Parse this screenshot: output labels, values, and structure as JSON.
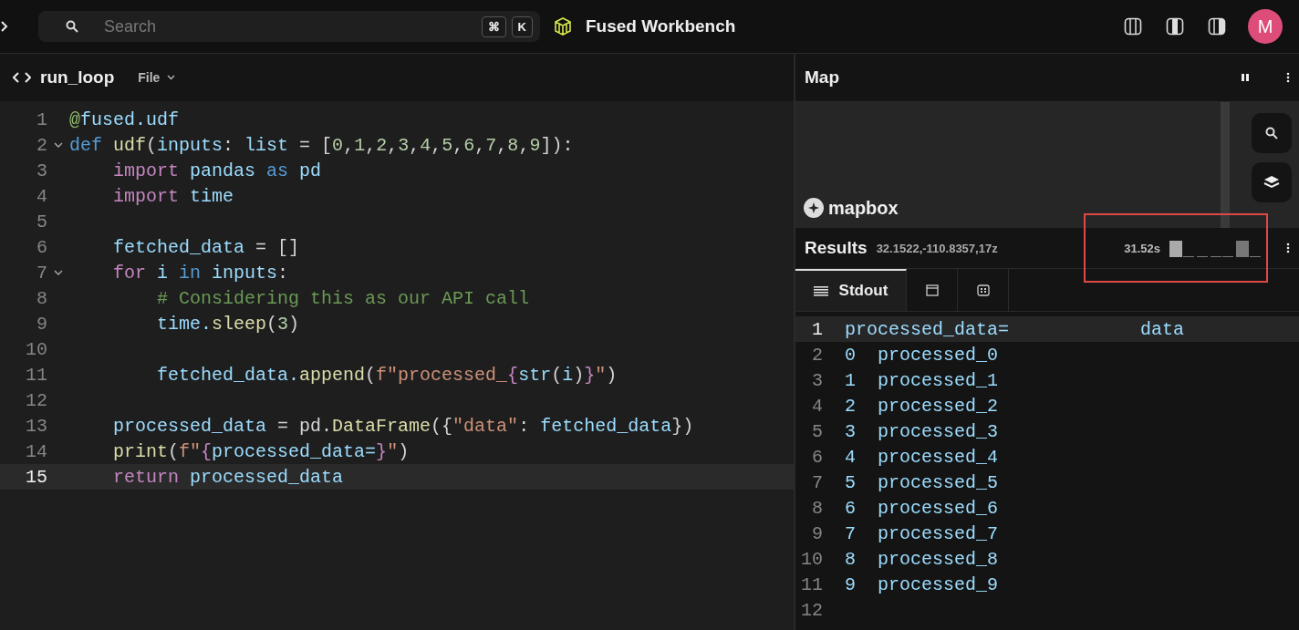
{
  "topbar": {
    "search": {
      "placeholder": "Search",
      "keys": [
        "⌘",
        "K"
      ]
    },
    "title": "Fused Workbench",
    "avatar": "M"
  },
  "editor": {
    "title": "run_loop",
    "menu": "File",
    "lines": [
      {
        "number": "1",
        "foldable": false,
        "current": false,
        "tokens": [
          {
            "text": "@",
            "kind": "dec"
          },
          {
            "text": "fused.udf",
            "kind": "id"
          }
        ]
      },
      {
        "number": "2",
        "foldable": true,
        "current": false,
        "tokens": [
          {
            "text": "def ",
            "kind": "kw"
          },
          {
            "text": "udf",
            "kind": "fn"
          },
          {
            "text": "(",
            "kind": "pun"
          },
          {
            "text": "inputs",
            "kind": "id"
          },
          {
            "text": ": ",
            "kind": "pun"
          },
          {
            "text": "list",
            "kind": "id"
          },
          {
            "text": " = [",
            "kind": "pun"
          },
          {
            "text": "0",
            "kind": "num"
          },
          {
            "text": ",",
            "kind": "pun"
          },
          {
            "text": "1",
            "kind": "num"
          },
          {
            "text": ",",
            "kind": "pun"
          },
          {
            "text": "2",
            "kind": "num"
          },
          {
            "text": ",",
            "kind": "pun"
          },
          {
            "text": "3",
            "kind": "num"
          },
          {
            "text": ",",
            "kind": "pun"
          },
          {
            "text": "4",
            "kind": "num"
          },
          {
            "text": ",",
            "kind": "pun"
          },
          {
            "text": "5",
            "kind": "num"
          },
          {
            "text": ",",
            "kind": "pun"
          },
          {
            "text": "6",
            "kind": "num"
          },
          {
            "text": ",",
            "kind": "pun"
          },
          {
            "text": "7",
            "kind": "num"
          },
          {
            "text": ",",
            "kind": "pun"
          },
          {
            "text": "8",
            "kind": "num"
          },
          {
            "text": ",",
            "kind": "pun"
          },
          {
            "text": "9",
            "kind": "num"
          },
          {
            "text": "]):",
            "kind": "pun"
          }
        ]
      },
      {
        "number": "3",
        "foldable": false,
        "current": false,
        "tokens": [
          {
            "text": "    import ",
            "kind": "ctl"
          },
          {
            "text": "pandas ",
            "kind": "id"
          },
          {
            "text": "as ",
            "kind": "kw"
          },
          {
            "text": "pd",
            "kind": "id"
          }
        ]
      },
      {
        "number": "4",
        "foldable": false,
        "current": false,
        "tokens": [
          {
            "text": "    import ",
            "kind": "ctl"
          },
          {
            "text": "time",
            "kind": "id"
          }
        ]
      },
      {
        "number": "5",
        "foldable": false,
        "current": false
      },
      {
        "number": "6",
        "foldable": false,
        "current": false,
        "tokens": [
          {
            "text": "    fetched_data",
            "kind": "id"
          },
          {
            "text": " = []",
            "kind": "pun"
          }
        ]
      },
      {
        "number": "7",
        "foldable": true,
        "current": false,
        "tokens": [
          {
            "text": "    for ",
            "kind": "ctl"
          },
          {
            "text": "i ",
            "kind": "id"
          },
          {
            "text": "in ",
            "kind": "kw"
          },
          {
            "text": "inputs",
            "kind": "id"
          },
          {
            "text": ":",
            "kind": "pun"
          }
        ]
      },
      {
        "number": "8",
        "foldable": false,
        "current": false,
        "tokens": [
          {
            "text": "        # Considering this as our API call",
            "kind": "com"
          }
        ]
      },
      {
        "number": "9",
        "foldable": false,
        "current": false,
        "tokens": [
          {
            "text": "        time.",
            "kind": "id"
          },
          {
            "text": "sleep",
            "kind": "fn"
          },
          {
            "text": "(",
            "kind": "pun"
          },
          {
            "text": "3",
            "kind": "num"
          },
          {
            "text": ")",
            "kind": "pun"
          }
        ]
      },
      {
        "number": "10",
        "foldable": false,
        "current": false
      },
      {
        "number": "11",
        "foldable": false,
        "current": false,
        "tokens": [
          {
            "text": "        fetched_data.",
            "kind": "id"
          },
          {
            "text": "append",
            "kind": "fn"
          },
          {
            "text": "(",
            "kind": "pun"
          },
          {
            "text": "f\"processed_",
            "kind": "str"
          },
          {
            "text": "{",
            "kind": "ctl"
          },
          {
            "text": "str",
            "kind": "id"
          },
          {
            "text": "(",
            "kind": "pun"
          },
          {
            "text": "i",
            "kind": "id"
          },
          {
            "text": ")",
            "kind": "pun"
          },
          {
            "text": "}",
            "kind": "ctl"
          },
          {
            "text": "\"",
            "kind": "str"
          },
          {
            "text": ")",
            "kind": "pun"
          }
        ]
      },
      {
        "number": "12",
        "foldable": false,
        "current": false
      },
      {
        "number": "13",
        "foldable": false,
        "current": false,
        "tokens": [
          {
            "text": "    processed_data",
            "kind": "id"
          },
          {
            "text": " = pd.",
            "kind": "pun"
          },
          {
            "text": "DataFrame",
            "kind": "fn"
          },
          {
            "text": "({",
            "kind": "pun"
          },
          {
            "text": "\"data\"",
            "kind": "str"
          },
          {
            "text": ": ",
            "kind": "pun"
          },
          {
            "text": "fetched_data",
            "kind": "id"
          },
          {
            "text": "})",
            "kind": "pun"
          }
        ]
      },
      {
        "number": "14",
        "foldable": false,
        "current": false,
        "tokens": [
          {
            "text": "    print",
            "kind": "fn"
          },
          {
            "text": "(",
            "kind": "pun"
          },
          {
            "text": "f\"",
            "kind": "str"
          },
          {
            "text": "{",
            "kind": "ctl"
          },
          {
            "text": "processed_data=",
            "kind": "id"
          },
          {
            "text": "}",
            "kind": "ctl"
          },
          {
            "text": "\"",
            "kind": "str"
          },
          {
            "text": ")",
            "kind": "pun"
          }
        ]
      },
      {
        "number": "15",
        "foldable": false,
        "current": true,
        "tokens": [
          {
            "text": "    return ",
            "kind": "ctl"
          },
          {
            "text": "processed_data",
            "kind": "id"
          }
        ]
      }
    ]
  },
  "map": {
    "title": "Map",
    "attribution": "mapbox"
  },
  "results": {
    "title": "Results",
    "coordinates": "32.1522,-110.8357,17z",
    "duration": "31.52s",
    "annotation": {
      "kind": "rectangle"
    },
    "tabs": [
      {
        "kind": "stdout",
        "label": "Stdout",
        "selected": true
      },
      {
        "kind": "window",
        "selected": false
      },
      {
        "kind": "table",
        "selected": false
      }
    ],
    "lines": [
      {
        "number": "1",
        "current": true,
        "text": "processed_data=            data"
      },
      {
        "number": "2",
        "current": false,
        "text": "0  processed_0"
      },
      {
        "number": "3",
        "current": false,
        "text": "1  processed_1"
      },
      {
        "number": "4",
        "current": false,
        "text": "2  processed_2"
      },
      {
        "number": "5",
        "current": false,
        "text": "3  processed_3"
      },
      {
        "number": "6",
        "current": false,
        "text": "4  processed_4"
      },
      {
        "number": "7",
        "current": false,
        "text": "5  processed_5"
      },
      {
        "number": "8",
        "current": false,
        "text": "6  processed_6"
      },
      {
        "number": "9",
        "current": false,
        "text": "7  processed_7"
      },
      {
        "number": "10",
        "current": false,
        "text": "8  processed_8"
      },
      {
        "number": "11",
        "current": false,
        "text": "9  processed_9"
      },
      {
        "number": "12",
        "current": false
      }
    ]
  }
}
